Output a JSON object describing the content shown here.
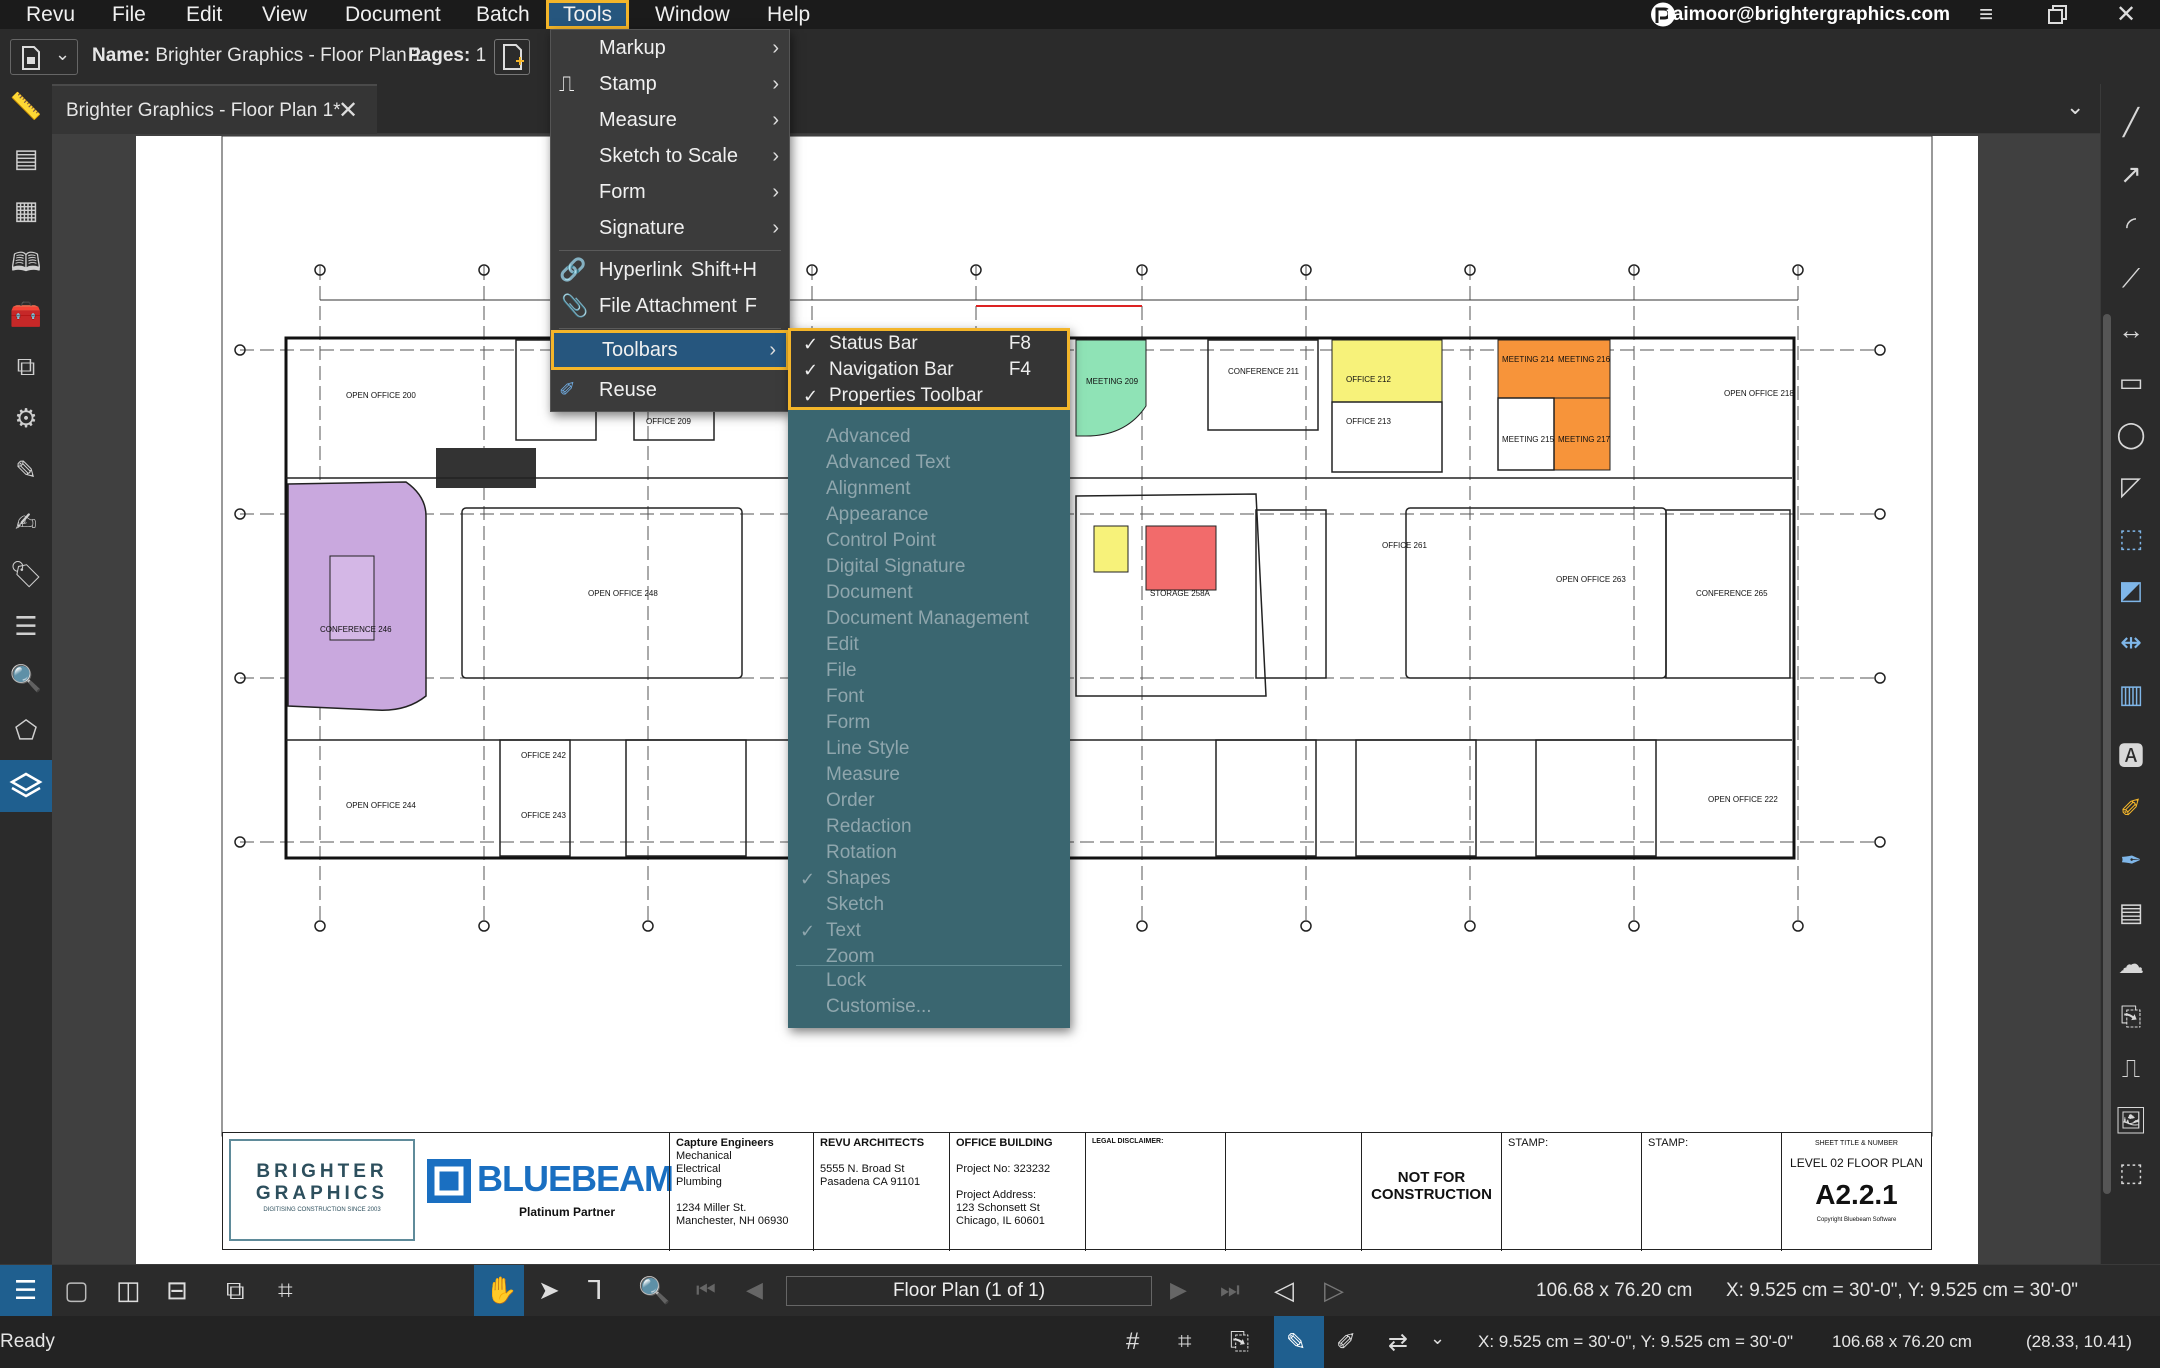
{
  "menubar": {
    "items": [
      "Revu",
      "File",
      "Edit",
      "View",
      "Document",
      "Batch",
      "Tools",
      "Window",
      "Help"
    ],
    "user": "taimoor@brightergraphics.com"
  },
  "propbar": {
    "name_label": "Name:",
    "name_value": "Brighter Graphics - Floor Plan 1",
    "pages_label": "Pages:",
    "pages_value": "1"
  },
  "tab": {
    "title": "Brighter Graphics - Floor Plan 1*"
  },
  "tools_menu": {
    "items": [
      {
        "label": "Markup",
        "submenu": true
      },
      {
        "label": "Stamp",
        "submenu": true
      },
      {
        "label": "Measure",
        "submenu": true
      },
      {
        "label": "Sketch to Scale",
        "submenu": true
      },
      {
        "label": "Form",
        "submenu": true
      },
      {
        "label": "Signature",
        "submenu": true
      },
      {
        "label": "Hyperlink",
        "shortcut": "Shift+H"
      },
      {
        "label": "File Attachment",
        "shortcut": "F"
      },
      {
        "label": "Toolbars",
        "submenu": true
      },
      {
        "label": "Reuse"
      }
    ]
  },
  "toolbars_submenu": {
    "checked_items": [
      {
        "label": "Status Bar",
        "shortcut": "F8"
      },
      {
        "label": "Navigation Bar",
        "shortcut": "F4"
      },
      {
        "label": "Properties Toolbar",
        "shortcut": ""
      }
    ],
    "items": [
      {
        "label": "Advanced",
        "checked": false
      },
      {
        "label": "Advanced Text",
        "checked": false
      },
      {
        "label": "Alignment",
        "checked": false
      },
      {
        "label": "Appearance",
        "checked": false
      },
      {
        "label": "Control Point",
        "checked": false
      },
      {
        "label": "Digital Signature",
        "checked": false
      },
      {
        "label": "Document",
        "checked": false
      },
      {
        "label": "Document Management",
        "checked": false
      },
      {
        "label": "Edit",
        "checked": false
      },
      {
        "label": "File",
        "checked": false
      },
      {
        "label": "Font",
        "checked": false
      },
      {
        "label": "Form",
        "checked": false
      },
      {
        "label": "Line Style",
        "checked": false
      },
      {
        "label": "Measure",
        "checked": false
      },
      {
        "label": "Order",
        "checked": false
      },
      {
        "label": "Redaction",
        "checked": false
      },
      {
        "label": "Rotation",
        "checked": false
      },
      {
        "label": "Shapes",
        "checked": true
      },
      {
        "label": "Sketch",
        "checked": false
      },
      {
        "label": "Text",
        "checked": true
      },
      {
        "label": "Zoom",
        "checked": false
      }
    ],
    "footer": [
      "Lock",
      "Customise..."
    ]
  },
  "bottombar": {
    "page_label": "Floor Plan (1 of 1)",
    "dimensions": "106.68 x 76.20 cm",
    "coords": "X: 9.525 cm = 30'-0\", Y: 9.525 cm = 30'-0\""
  },
  "statusbar": {
    "ready": "Ready",
    "coords": "X: 9.525 cm = 30'-0\", Y: 9.525 cm = 30'-0\"",
    "dimensions": "106.68 x 76.20 cm",
    "position": "(28.33, 10.41)"
  },
  "titleblock": {
    "brand": "BRIGHTER GRAPHICS",
    "brand_tagline": "DIGITISING CONSTRUCTION SINCE 2003",
    "bluebeam": "BLUEBEAM",
    "bluebeam_sub": "Platinum Partner",
    "engineers": [
      "Capture Engineers",
      "Mechanical",
      "Electrical",
      "Plumbing",
      "",
      "1234 Miller St.",
      "Manchester, NH 06930"
    ],
    "architects": [
      "REVU ARCHITECTS",
      "",
      "5555 N. Broad St",
      "Pasadena CA 91101"
    ],
    "building": [
      "OFFICE BUILDING",
      "",
      "Project No: 323232",
      "",
      "Project Address:",
      "123 Schonsett St",
      "Chicago, IL 60601"
    ],
    "disclaimer_title": "LEGAL DISCLAIMER:",
    "not_for": "NOT FOR CONSTRUCTION",
    "stamp1": "STAMP:",
    "stamp2": "STAMP:",
    "sheet_title_label": "SHEET TITLE & NUMBER",
    "sheet_title": "LEVEL 02 FLOOR PLAN",
    "sheet_number": "A2.2.1",
    "copyright": "Copyright Bluebeam Software"
  },
  "colors": {
    "accent": "#f3b52a",
    "menu_highlight": "#26567e",
    "submenu_bg": "#3a6670",
    "bluebeam_blue": "#1a6fc1",
    "room_purple": "#c9a8de",
    "room_orange": "#f7943a",
    "room_yellow": "#f7f27a",
    "room_green": "#8fe3b6",
    "room_red": "#f26b6b"
  }
}
